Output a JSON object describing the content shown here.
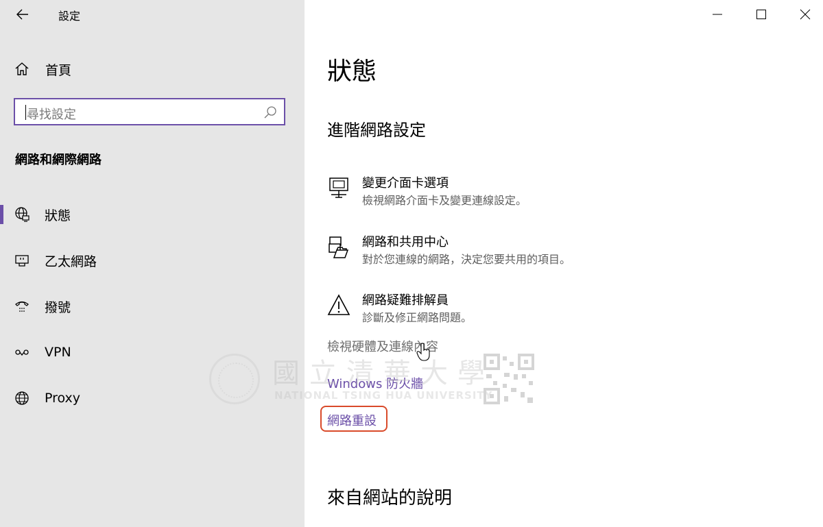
{
  "app": {
    "title": "設定"
  },
  "window_controls": {
    "minimize": "minimize-icon",
    "maximize": "maximize-icon",
    "close": "close-icon"
  },
  "sidebar": {
    "home_label": "首頁",
    "search_placeholder": "尋找設定",
    "section_title": "網路和網際網路",
    "items": [
      {
        "label": "狀態",
        "icon": "globe-monitor-icon",
        "selected": true
      },
      {
        "label": "乙太網路",
        "icon": "ethernet-icon",
        "selected": false
      },
      {
        "label": "撥號",
        "icon": "dialup-icon",
        "selected": false
      },
      {
        "label": "VPN",
        "icon": "vpn-icon",
        "selected": false
      },
      {
        "label": "Proxy",
        "icon": "globe-icon",
        "selected": false
      }
    ]
  },
  "main": {
    "page_title": "狀態",
    "advanced_title": "進階網路設定",
    "links": [
      {
        "title": "變更介面卡選項",
        "desc": "檢視網路介面卡及變更連線設定。",
        "icon": "network-adapter-icon"
      },
      {
        "title": "網路和共用中心",
        "desc": "對於您連線的網路，決定您要共用的項目。",
        "icon": "sharing-center-icon"
      },
      {
        "title": "網路疑難排解員",
        "desc": "診斷及修正網路問題。",
        "icon": "warning-icon"
      }
    ],
    "view_hardware": "檢視硬體及連線內容",
    "firewall": "Windows 防火牆",
    "network_reset": "網路重設",
    "help_title": "來自網站的說明"
  },
  "watermark": {
    "name": "國立清華大學",
    "english": "NATIONAL TSING HUA UNIVERSITY"
  },
  "colors": {
    "accent": "#6b4fa8",
    "highlight": "#d94a2a",
    "sidebar_bg": "#e6e6e6"
  }
}
